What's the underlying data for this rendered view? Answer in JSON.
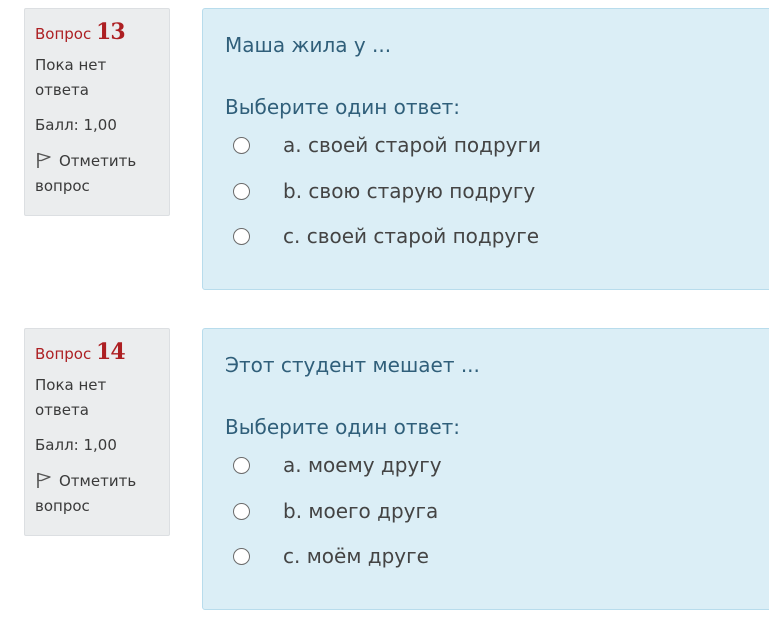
{
  "questions": [
    {
      "label": "Вопрос",
      "number": "13",
      "state": "Пока нет ответа",
      "grade": "Балл: 1,00",
      "flag_label": "Отметить вопрос",
      "text": "Маша жила у ...",
      "prompt": "Выберите один ответ:",
      "answers": [
        "a. своей старой подруги",
        "b. свою старую подругу",
        "c. своей старой подруге"
      ]
    },
    {
      "label": "Вопрос",
      "number": "14",
      "state": "Пока нет ответа",
      "grade": "Балл: 1,00",
      "flag_label": "Отметить вопрос",
      "text": "Этот студент мешает ...",
      "prompt": "Выберите один ответ:",
      "answers": [
        "a. моему другу",
        "b. моего друга",
        "c. моём друге"
      ]
    }
  ],
  "icons": {
    "flag": "flag-icon",
    "radio": "radio-icon"
  },
  "colors": {
    "question_number": "#ad1f22",
    "info_bg": "#ebedee",
    "content_bg": "#dbeef6",
    "question_text": "#305f7a"
  }
}
